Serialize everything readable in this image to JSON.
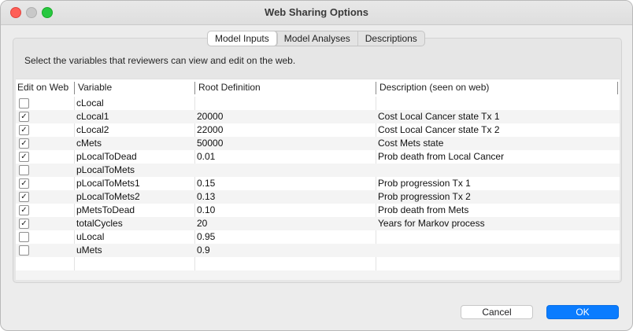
{
  "window": {
    "title": "Web Sharing Options"
  },
  "tabs": [
    {
      "label": "Model Inputs",
      "active": true
    },
    {
      "label": "Model Analyses",
      "active": false
    },
    {
      "label": "Descriptions",
      "active": false
    }
  ],
  "instructions": "Select the variables that reviewers can view and edit on the web.",
  "table": {
    "columns": [
      "Edit on Web",
      "Variable",
      "Root Definition",
      "Description (seen on web)"
    ],
    "rows": [
      {
        "checked": false,
        "variable": "cLocal",
        "definition": "",
        "description": ""
      },
      {
        "checked": true,
        "variable": "cLocal1",
        "definition": "20000",
        "description": "Cost Local Cancer state Tx 1"
      },
      {
        "checked": true,
        "variable": "cLocal2",
        "definition": "22000",
        "description": "Cost Local Cancer state Tx 2"
      },
      {
        "checked": true,
        "variable": "cMets",
        "definition": "50000",
        "description": "Cost Mets state"
      },
      {
        "checked": true,
        "variable": "pLocalToDead",
        "definition": "0.01",
        "description": "Prob death from Local Cancer"
      },
      {
        "checked": false,
        "variable": "pLocalToMets",
        "definition": "",
        "description": ""
      },
      {
        "checked": true,
        "variable": "pLocalToMets1",
        "definition": "0.15",
        "description": "Prob progression Tx 1"
      },
      {
        "checked": true,
        "variable": "pLocalToMets2",
        "definition": "0.13",
        "description": "Prob progression Tx 2"
      },
      {
        "checked": true,
        "variable": "pMetsToDead",
        "definition": "0.10",
        "description": "Prob death from Mets"
      },
      {
        "checked": true,
        "variable": "totalCycles",
        "definition": "20",
        "description": "Years for Markov process"
      },
      {
        "checked": false,
        "variable": "uLocal",
        "definition": "0.95",
        "description": ""
      },
      {
        "checked": false,
        "variable": "uMets",
        "definition": "0.9",
        "description": ""
      }
    ]
  },
  "buttons": {
    "cancel": "Cancel",
    "ok": "OK"
  },
  "colors": {
    "accent": "#0a7cff",
    "close": "#fe5f57",
    "zoom": "#28c840"
  }
}
